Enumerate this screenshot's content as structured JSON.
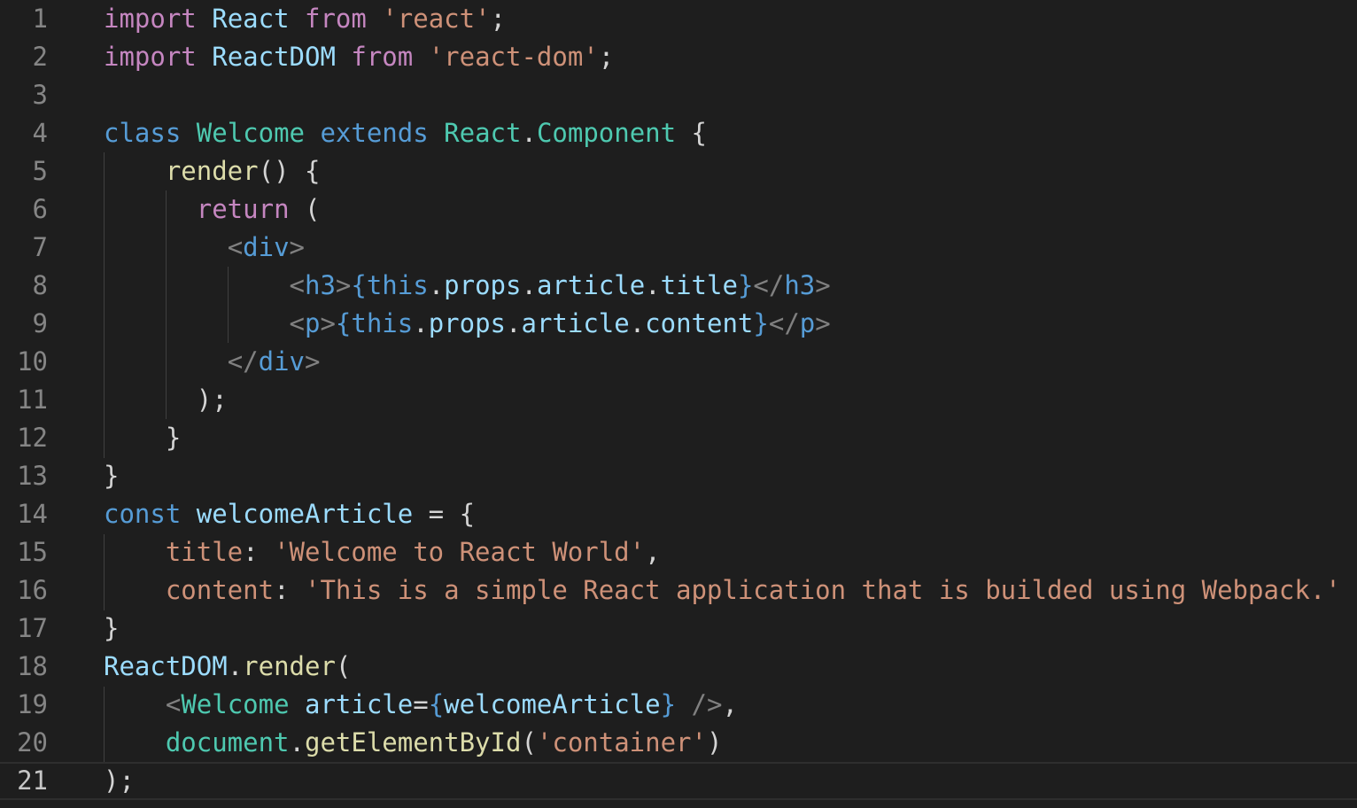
{
  "editor": {
    "theme_colors": {
      "background": "#1e1e1e",
      "line_number": "#858585",
      "keyword_purple": "#c586c0",
      "identifier": "#9cdcfe",
      "keyword_blue": "#569cd6",
      "type": "#4ec9b0",
      "function": "#dcdcaa",
      "string": "#ce9178",
      "punctuation": "#d4d4d4",
      "tag_bracket": "#808080"
    },
    "lines": [
      {
        "number": "1",
        "tokens": [
          {
            "t": "import",
            "c": "purple"
          },
          {
            "t": " ",
            "c": "punct"
          },
          {
            "t": "React",
            "c": "lightblue"
          },
          {
            "t": " ",
            "c": "punct"
          },
          {
            "t": "from",
            "c": "purple"
          },
          {
            "t": " ",
            "c": "punct"
          },
          {
            "t": "'react'",
            "c": "string"
          },
          {
            "t": ";",
            "c": "punct"
          }
        ]
      },
      {
        "number": "2",
        "tokens": [
          {
            "t": "import",
            "c": "purple"
          },
          {
            "t": " ",
            "c": "punct"
          },
          {
            "t": "ReactDOM",
            "c": "lightblue"
          },
          {
            "t": " ",
            "c": "punct"
          },
          {
            "t": "from",
            "c": "purple"
          },
          {
            "t": " ",
            "c": "punct"
          },
          {
            "t": "'react-dom'",
            "c": "string"
          },
          {
            "t": ";",
            "c": "punct"
          }
        ]
      },
      {
        "number": "3",
        "tokens": []
      },
      {
        "number": "4",
        "tokens": [
          {
            "t": "class",
            "c": "blue"
          },
          {
            "t": " ",
            "c": "punct"
          },
          {
            "t": "Welcome",
            "c": "teal"
          },
          {
            "t": " ",
            "c": "punct"
          },
          {
            "t": "extends",
            "c": "blue"
          },
          {
            "t": " ",
            "c": "punct"
          },
          {
            "t": "React",
            "c": "teal"
          },
          {
            "t": ".",
            "c": "punct"
          },
          {
            "t": "Component",
            "c": "teal"
          },
          {
            "t": " {",
            "c": "punct"
          }
        ]
      },
      {
        "number": "5",
        "tokens": [
          {
            "t": "    ",
            "c": "punct"
          },
          {
            "t": "render",
            "c": "yellow"
          },
          {
            "t": "() {",
            "c": "punct"
          }
        ]
      },
      {
        "number": "6",
        "tokens": [
          {
            "t": "      ",
            "c": "punct"
          },
          {
            "t": "return",
            "c": "purple"
          },
          {
            "t": " (",
            "c": "punct"
          }
        ]
      },
      {
        "number": "7",
        "tokens": [
          {
            "t": "        ",
            "c": "punct"
          },
          {
            "t": "<",
            "c": "gray"
          },
          {
            "t": "div",
            "c": "blue"
          },
          {
            "t": ">",
            "c": "gray"
          }
        ]
      },
      {
        "number": "8",
        "tokens": [
          {
            "t": "            ",
            "c": "punct"
          },
          {
            "t": "<",
            "c": "gray"
          },
          {
            "t": "h3",
            "c": "blue"
          },
          {
            "t": ">",
            "c": "gray"
          },
          {
            "t": "{",
            "c": "blue"
          },
          {
            "t": "this",
            "c": "blue"
          },
          {
            "t": ".",
            "c": "punct"
          },
          {
            "t": "props",
            "c": "lightblue"
          },
          {
            "t": ".",
            "c": "punct"
          },
          {
            "t": "article",
            "c": "lightblue"
          },
          {
            "t": ".",
            "c": "punct"
          },
          {
            "t": "title",
            "c": "lightblue"
          },
          {
            "t": "}",
            "c": "blue"
          },
          {
            "t": "</",
            "c": "gray"
          },
          {
            "t": "h3",
            "c": "blue"
          },
          {
            "t": ">",
            "c": "gray"
          }
        ]
      },
      {
        "number": "9",
        "tokens": [
          {
            "t": "            ",
            "c": "punct"
          },
          {
            "t": "<",
            "c": "gray"
          },
          {
            "t": "p",
            "c": "blue"
          },
          {
            "t": ">",
            "c": "gray"
          },
          {
            "t": "{",
            "c": "blue"
          },
          {
            "t": "this",
            "c": "blue"
          },
          {
            "t": ".",
            "c": "punct"
          },
          {
            "t": "props",
            "c": "lightblue"
          },
          {
            "t": ".",
            "c": "punct"
          },
          {
            "t": "article",
            "c": "lightblue"
          },
          {
            "t": ".",
            "c": "punct"
          },
          {
            "t": "content",
            "c": "lightblue"
          },
          {
            "t": "}",
            "c": "blue"
          },
          {
            "t": "</",
            "c": "gray"
          },
          {
            "t": "p",
            "c": "blue"
          },
          {
            "t": ">",
            "c": "gray"
          }
        ]
      },
      {
        "number": "10",
        "tokens": [
          {
            "t": "        ",
            "c": "punct"
          },
          {
            "t": "</",
            "c": "gray"
          },
          {
            "t": "div",
            "c": "blue"
          },
          {
            "t": ">",
            "c": "gray"
          }
        ]
      },
      {
        "number": "11",
        "tokens": [
          {
            "t": "      ",
            "c": "punct"
          },
          {
            "t": ");",
            "c": "punct"
          }
        ]
      },
      {
        "number": "12",
        "tokens": [
          {
            "t": "    ",
            "c": "punct"
          },
          {
            "t": "}",
            "c": "punct"
          }
        ]
      },
      {
        "number": "13",
        "tokens": [
          {
            "t": "}",
            "c": "punct"
          }
        ]
      },
      {
        "number": "14",
        "tokens": [
          {
            "t": "const",
            "c": "blue"
          },
          {
            "t": " ",
            "c": "punct"
          },
          {
            "t": "welcomeArticle",
            "c": "lightblue"
          },
          {
            "t": " = {",
            "c": "punct"
          }
        ]
      },
      {
        "number": "15",
        "tokens": [
          {
            "t": "    ",
            "c": "punct"
          },
          {
            "t": "title",
            "c": "string"
          },
          {
            "t": ": ",
            "c": "punct"
          },
          {
            "t": "'Welcome to React World'",
            "c": "string"
          },
          {
            "t": ",",
            "c": "punct"
          }
        ]
      },
      {
        "number": "16",
        "tokens": [
          {
            "t": "    ",
            "c": "punct"
          },
          {
            "t": "content",
            "c": "string"
          },
          {
            "t": ": ",
            "c": "punct"
          },
          {
            "t": "'This is a simple React application that is builded using Webpack.'",
            "c": "string"
          }
        ]
      },
      {
        "number": "17",
        "tokens": [
          {
            "t": "}",
            "c": "punct"
          }
        ]
      },
      {
        "number": "18",
        "tokens": [
          {
            "t": "ReactDOM",
            "c": "lightblue"
          },
          {
            "t": ".",
            "c": "punct"
          },
          {
            "t": "render",
            "c": "yellow"
          },
          {
            "t": "(",
            "c": "punct"
          }
        ]
      },
      {
        "number": "19",
        "tokens": [
          {
            "t": "    ",
            "c": "punct"
          },
          {
            "t": "<",
            "c": "gray"
          },
          {
            "t": "Welcome",
            "c": "teal"
          },
          {
            "t": " ",
            "c": "punct"
          },
          {
            "t": "article",
            "c": "lightblue"
          },
          {
            "t": "=",
            "c": "punct"
          },
          {
            "t": "{",
            "c": "blue"
          },
          {
            "t": "welcomeArticle",
            "c": "lightblue"
          },
          {
            "t": "}",
            "c": "blue"
          },
          {
            "t": " />",
            "c": "gray"
          },
          {
            "t": ",",
            "c": "punct"
          }
        ]
      },
      {
        "number": "20",
        "tokens": [
          {
            "t": "    ",
            "c": "punct"
          },
          {
            "t": "document",
            "c": "teal"
          },
          {
            "t": ".",
            "c": "punct"
          },
          {
            "t": "getElementById",
            "c": "yellow"
          },
          {
            "t": "(",
            "c": "punct"
          },
          {
            "t": "'container'",
            "c": "string"
          },
          {
            "t": ")",
            "c": "punct"
          }
        ]
      },
      {
        "number": "21",
        "tokens": [
          {
            "t": ");",
            "c": "punct"
          }
        ]
      }
    ],
    "current_line": "21"
  }
}
